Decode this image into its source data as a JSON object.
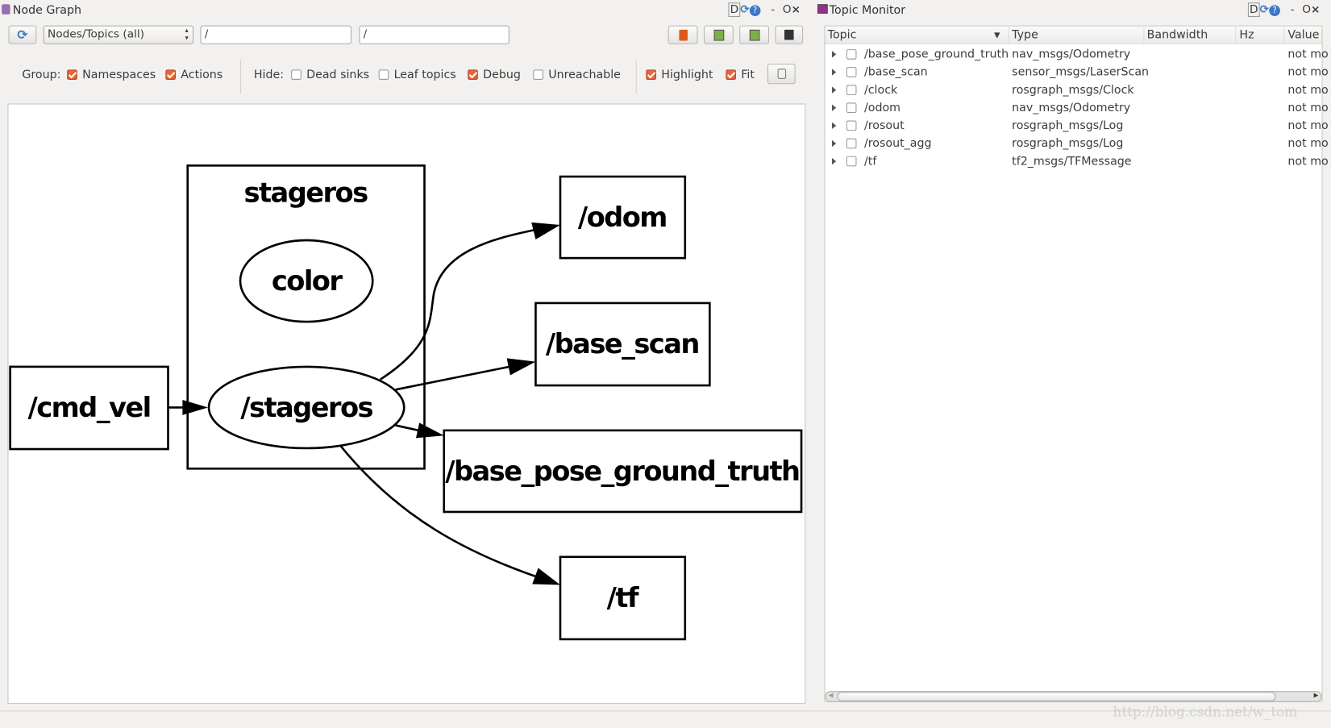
{
  "node_graph": {
    "title": "Node Graph",
    "window_controls": [
      "D",
      "-",
      "O",
      "×"
    ],
    "mode_select": "Nodes/Topics (all)",
    "node_filter": "/",
    "topic_filter": "/",
    "group_label": "Group:",
    "group_options": [
      {
        "label": "Namespaces",
        "checked": true
      },
      {
        "label": "Actions",
        "checked": true
      }
    ],
    "hide_label": "Hide:",
    "hide_options": [
      {
        "label": "Dead sinks",
        "checked": false
      },
      {
        "label": "Leaf topics",
        "checked": false
      },
      {
        "label": "Debug",
        "checked": true
      },
      {
        "label": "Unreachable",
        "checked": false
      }
    ],
    "view_options": [
      {
        "label": "Highlight",
        "checked": true
      },
      {
        "label": "Fit",
        "checked": true
      }
    ],
    "graph": {
      "cluster": "stageros",
      "nodes": {
        "color": "color",
        "stageros": "/stageros",
        "cmd_vel": "/cmd_vel",
        "odom": "/odom",
        "base_scan": "/base_scan",
        "base_pose_ground_truth": "/base_pose_ground_truth",
        "tf": "/tf"
      },
      "edges": [
        [
          "/cmd_vel",
          "/stageros"
        ],
        [
          "/stageros",
          "/odom"
        ],
        [
          "/stageros",
          "/base_scan"
        ],
        [
          "/stageros",
          "/base_pose_ground_truth"
        ],
        [
          "/stageros",
          "/tf"
        ]
      ]
    }
  },
  "topic_monitor": {
    "title": "Topic Monitor",
    "window_controls": [
      "D",
      "-",
      "O",
      "×"
    ],
    "columns": [
      "Topic",
      "Type",
      "Bandwidth",
      "Hz",
      "Value"
    ],
    "rows": [
      {
        "topic": "/base_pose_ground_truth",
        "type": "nav_msgs/Odometry",
        "value": "not mo"
      },
      {
        "topic": "/base_scan",
        "type": "sensor_msgs/LaserScan",
        "value": "not mo"
      },
      {
        "topic": "/clock",
        "type": "rosgraph_msgs/Clock",
        "value": "not mo"
      },
      {
        "topic": "/odom",
        "type": "nav_msgs/Odometry",
        "value": "not mo"
      },
      {
        "topic": "/rosout",
        "type": "rosgraph_msgs/Log",
        "value": "not mo"
      },
      {
        "topic": "/rosout_agg",
        "type": "rosgraph_msgs/Log",
        "value": "not mo"
      },
      {
        "topic": "/tf",
        "type": "tf2_msgs/TFMessage",
        "value": "not mo"
      }
    ]
  },
  "watermark": "http://blog.csdn.net/w_tom"
}
